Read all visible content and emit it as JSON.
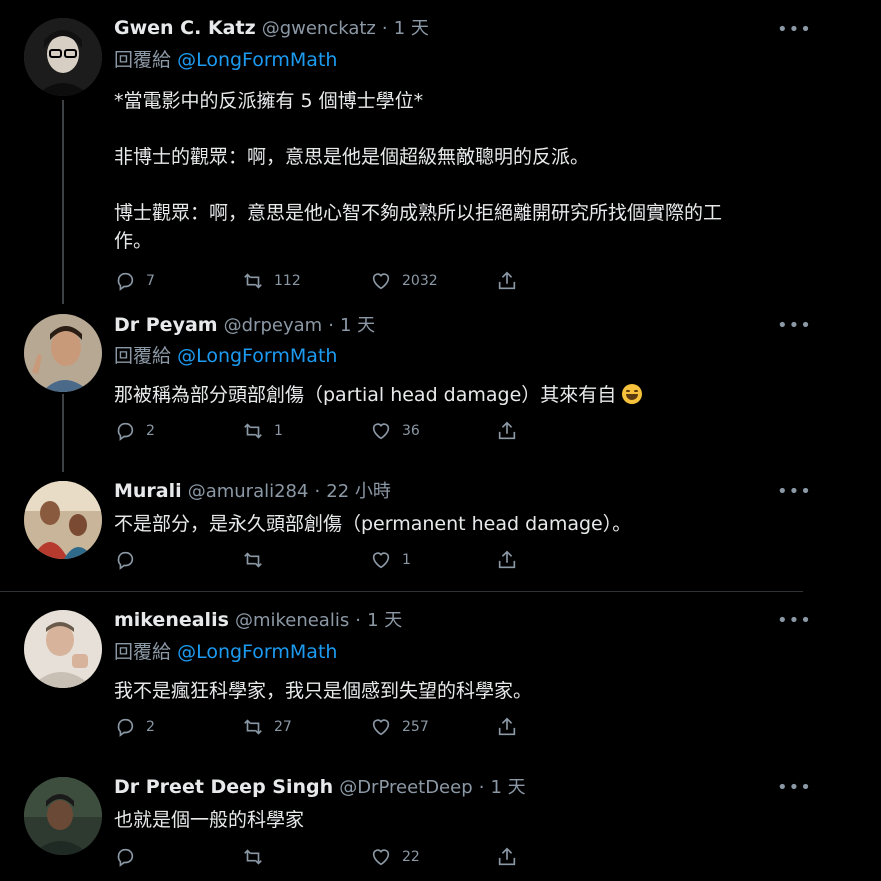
{
  "tweets": [
    {
      "name": "Gwen C. Katz",
      "handle": "@gwenckatz",
      "time": "1 天",
      "reply_label": "回覆給",
      "reply_to": "@LongFormMath",
      "text": "*當電影中的反派擁有 5 個博士學位*\n\n非博士的觀眾：啊，意思是他是個超級無敵聰明的反派。\n\n博士觀眾：啊，意思是他心智不夠成熟所以拒絕離開研究所找個實際的工\n作。",
      "replies": "7",
      "retweets": "112",
      "likes": "2032",
      "avatar_color": "#2a2a2a"
    },
    {
      "name": "Dr Peyam",
      "handle": "@drpeyam",
      "time": "1 天",
      "reply_label": "回覆給",
      "reply_to": "@LongFormMath",
      "text": "那被稱為部分頭部創傷（partial head damage）其來有自",
      "replies": "2",
      "retweets": "1",
      "likes": "36",
      "avatar_color": "#8a7a66"
    },
    {
      "name": "Murali",
      "handle": "@amurali284",
      "time": "22 小時",
      "text": "不是部分，是永久頭部創傷（permanent head damage）。",
      "replies": "",
      "retweets": "",
      "likes": "1",
      "avatar_color": "#9a4a3a"
    },
    {
      "name": "mikenealis",
      "handle": "@mikenealis",
      "time": "1 天",
      "reply_label": "回覆給",
      "reply_to": "@LongFormMath",
      "text": "我不是瘋狂科學家，我只是個感到失望的科學家。",
      "replies": "2",
      "retweets": "27",
      "likes": "257",
      "avatar_color": "#c9c2b8"
    },
    {
      "name": "Dr Preet Deep Singh",
      "handle": "@DrPreetDeep",
      "time": "1 天",
      "text": "也就是個一般的科學家",
      "replies": "",
      "retweets": "",
      "likes": "22",
      "avatar_color": "#4a5a4a"
    }
  ],
  "separator": "·",
  "more_glyph": "•••"
}
